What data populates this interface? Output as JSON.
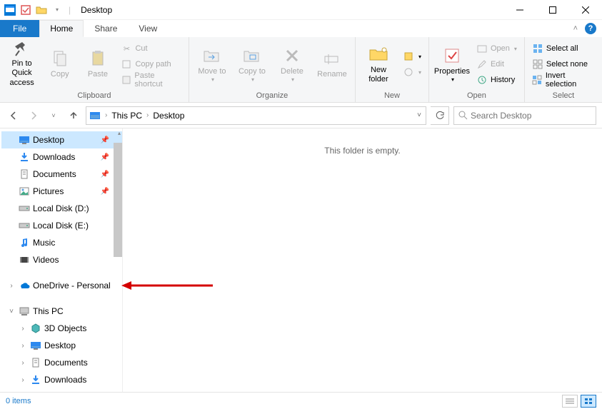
{
  "title": "Desktop",
  "tabs": {
    "file": "File",
    "home": "Home",
    "share": "Share",
    "view": "View"
  },
  "ribbon": {
    "clipboard": {
      "label": "Clipboard",
      "pin": "Pin to Quick access",
      "copy": "Copy",
      "paste": "Paste",
      "cut": "Cut",
      "copy_path": "Copy path",
      "paste_shortcut": "Paste shortcut"
    },
    "organize": {
      "label": "Organize",
      "move_to": "Move to",
      "copy_to": "Copy to",
      "delete": "Delete",
      "rename": "Rename"
    },
    "new": {
      "label": "New",
      "new_folder": "New folder"
    },
    "open": {
      "label": "Open",
      "properties": "Properties",
      "open": "Open",
      "edit": "Edit",
      "history": "History"
    },
    "select": {
      "label": "Select",
      "all": "Select all",
      "none": "Select none",
      "invert": "Invert selection"
    }
  },
  "breadcrumb": {
    "this_pc": "This PC",
    "desktop": "Desktop"
  },
  "search_placeholder": "Search Desktop",
  "nav": {
    "quick": [
      {
        "label": "Desktop",
        "icon": "desktop",
        "pin": true,
        "selected": true
      },
      {
        "label": "Downloads",
        "icon": "downloads",
        "pin": true
      },
      {
        "label": "Documents",
        "icon": "documents",
        "pin": true
      },
      {
        "label": "Pictures",
        "icon": "pictures",
        "pin": true
      },
      {
        "label": "Local Disk (D:)",
        "icon": "drive"
      },
      {
        "label": "Local Disk (E:)",
        "icon": "drive"
      },
      {
        "label": "Music",
        "icon": "music"
      },
      {
        "label": "Videos",
        "icon": "videos"
      }
    ],
    "onedrive": "OneDrive - Personal",
    "this_pc": "This PC",
    "thispc_items": [
      {
        "label": "3D Objects",
        "icon": "objects"
      },
      {
        "label": "Desktop",
        "icon": "desktop"
      },
      {
        "label": "Documents",
        "icon": "documents"
      },
      {
        "label": "Downloads",
        "icon": "downloads"
      }
    ]
  },
  "empty_msg": "This folder is empty.",
  "status": "0 items"
}
